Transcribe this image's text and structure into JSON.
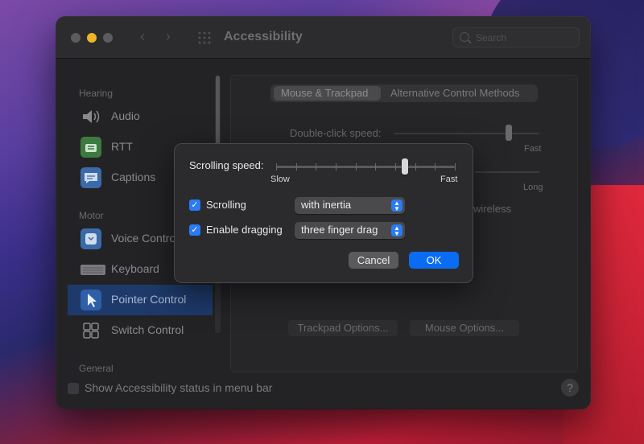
{
  "window": {
    "title": "Accessibility",
    "search_placeholder": "Search",
    "nav_back": "‹",
    "nav_forward": "›"
  },
  "sidebar": {
    "sections": [
      {
        "header": "Hearing"
      },
      {
        "header": "Motor"
      },
      {
        "header": "General"
      }
    ],
    "items": [
      {
        "label": "Audio",
        "icon": "speaker-icon"
      },
      {
        "label": "RTT",
        "icon": "rtt-icon"
      },
      {
        "label": "Captions",
        "icon": "captions-icon"
      },
      {
        "label": "Voice Control",
        "icon": "voice-control-icon"
      },
      {
        "label": "Keyboard",
        "icon": "keyboard-icon"
      },
      {
        "label": "Pointer Control",
        "icon": "pointer-icon",
        "selected": true
      },
      {
        "label": "Switch Control",
        "icon": "switch-control-icon"
      }
    ]
  },
  "panel": {
    "tabs": [
      {
        "label": "Mouse & Trackpad",
        "selected": true
      },
      {
        "label": "Alternative Control Methods"
      }
    ],
    "double_click_label": "Double-click speed:",
    "fast_label": "Fast",
    "long_label": "Long",
    "wireless_fragment": "wireless",
    "trackpad_options": "Trackpad Options...",
    "mouse_options": "Mouse Options..."
  },
  "footer": {
    "status_label": "Show Accessibility status in menu bar",
    "status_checked": false,
    "help": "?"
  },
  "dialog": {
    "scrolling_speed_label": "Scrolling speed:",
    "scrolling_speed_value": 0.72,
    "slow_label": "Slow",
    "fast_label": "Fast",
    "scrolling": {
      "label": "Scrolling",
      "checked": true,
      "value": "with inertia"
    },
    "dragging": {
      "label": "Enable dragging",
      "checked": true,
      "value": "three finger drag"
    },
    "cancel_label": "Cancel",
    "ok_label": "OK"
  },
  "colors": {
    "accent": "#0a6cf2",
    "selected_row": "#1e3a6a"
  }
}
